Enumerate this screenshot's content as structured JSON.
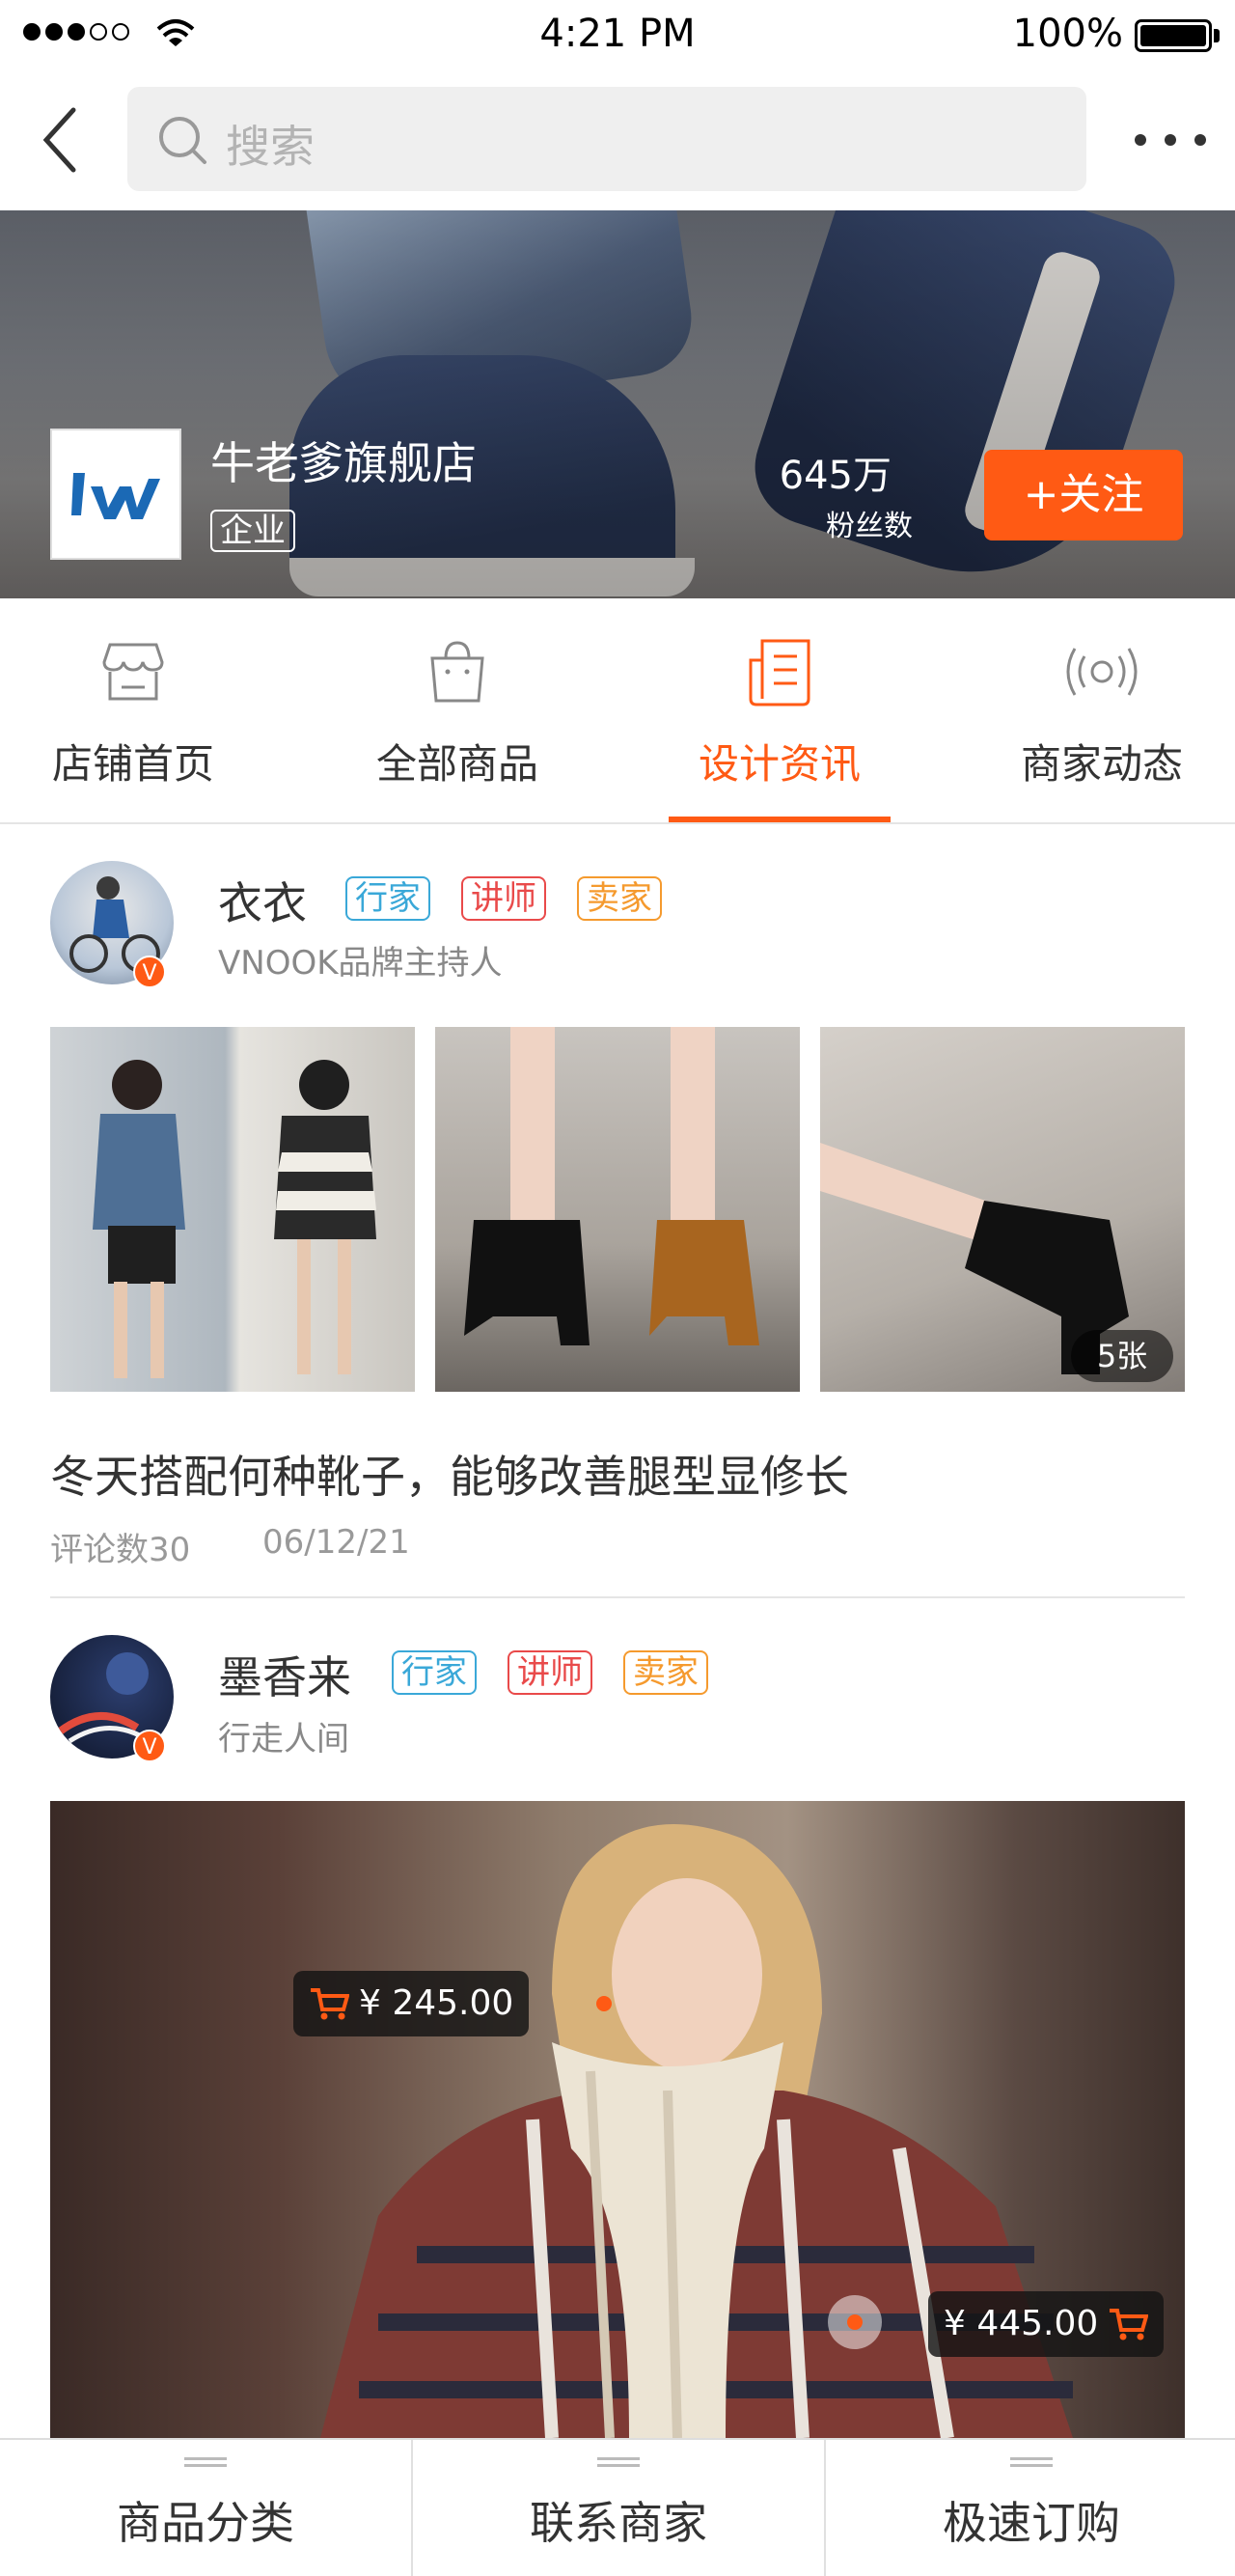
{
  "status_bar": {
    "time": "4:21 PM",
    "battery": "100%",
    "signal_icon": "signal-dots-icon",
    "wifi_icon": "wifi-icon",
    "battery_icon": "battery-icon"
  },
  "nav": {
    "search_placeholder": "搜索",
    "back_icon": "chevron-left-icon",
    "more_icon": "more-horizontal-icon"
  },
  "store": {
    "name": "牛老爹旗舰店",
    "badge": "企业",
    "fans_count": "645万",
    "fans_label": "粉丝数",
    "follow_label": "+关注"
  },
  "tabs": [
    {
      "label": "店铺首页",
      "icon": "storefront-icon",
      "active": false
    },
    {
      "label": "全部商品",
      "icon": "shopping-bag-icon",
      "active": false
    },
    {
      "label": "设计资讯",
      "icon": "article-icon",
      "active": true
    },
    {
      "label": "商家动态",
      "icon": "broadcast-icon",
      "active": false
    }
  ],
  "posts": [
    {
      "author": "衣衣",
      "subtitle": "VNOOK品牌主持人",
      "tags": [
        "行家",
        "讲师",
        "卖家"
      ],
      "verified_mark": "V",
      "image_count": "5张",
      "title": "冬天搭配何种靴子，能够改善腿型显修长",
      "comments": "评论数30",
      "date": "06/12/21"
    },
    {
      "author": "墨香来",
      "subtitle": "行走人间",
      "tags": [
        "行家",
        "讲师",
        "卖家"
      ],
      "verified_mark": "V",
      "price_tags": [
        "¥ 245.00",
        "¥ 445.00"
      ]
    }
  ],
  "bottom_bar": {
    "items": [
      "商品分类",
      "联系商家",
      "极速订购"
    ]
  },
  "colors": {
    "accent": "#ff5a14",
    "tag_blue": "#3aa8d8",
    "tag_red": "#e94a4a",
    "tag_orange": "#f59a2e"
  }
}
